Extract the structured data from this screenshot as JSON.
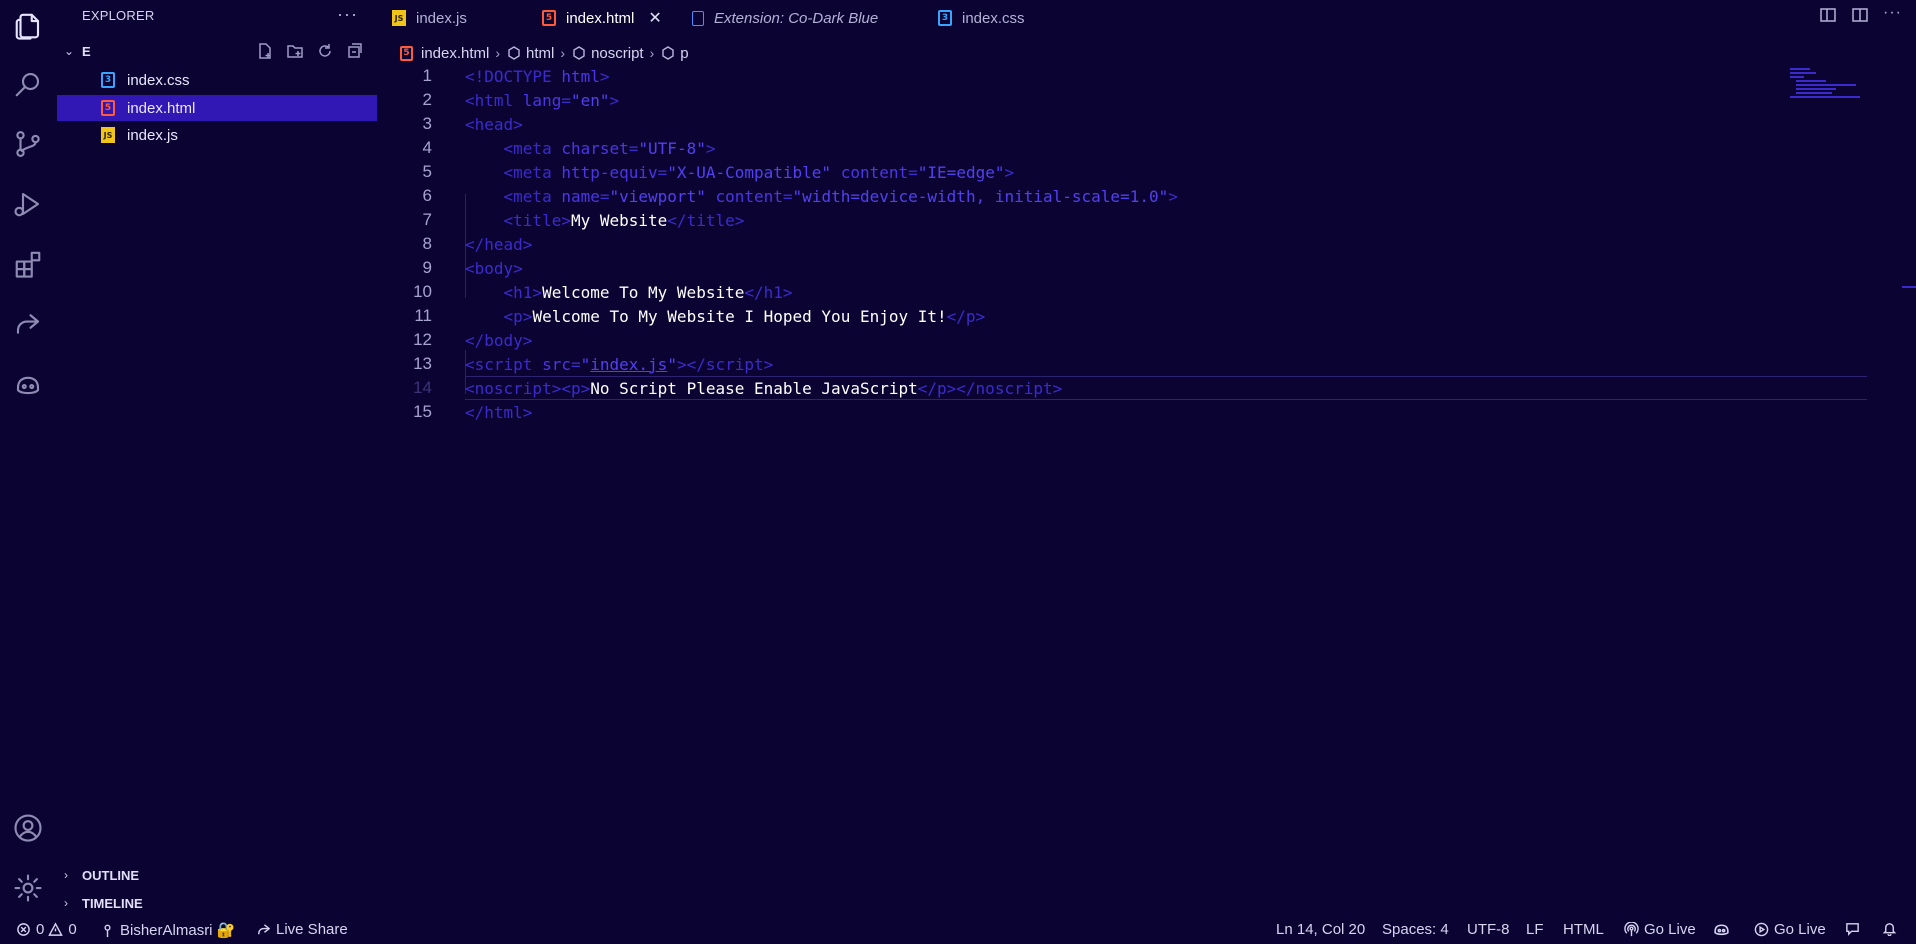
{
  "sidebar": {
    "title": "EXPLORER",
    "folder": "E",
    "files": [
      {
        "name": "index.css",
        "type": "css",
        "selected": false
      },
      {
        "name": "index.html",
        "type": "html",
        "selected": true
      },
      {
        "name": "index.js",
        "type": "js",
        "selected": false
      }
    ],
    "panels": [
      "OUTLINE",
      "TIMELINE"
    ]
  },
  "tabs": [
    {
      "label": "index.js",
      "icon": "js-file-icon"
    },
    {
      "label": "index.html",
      "icon": "html-file-icon",
      "active": true
    },
    {
      "label": "Extension: Co-Dark Blue",
      "icon": "file-icon",
      "italic": true
    },
    {
      "label": "index.css",
      "icon": "css-file-icon"
    }
  ],
  "breadcrumb": [
    "index.html",
    "html",
    "noscript",
    "p"
  ],
  "editor": {
    "line_numbers": [
      "1",
      "2",
      "3",
      "4",
      "5",
      "6",
      "7",
      "8",
      "9",
      "10",
      "11",
      "12",
      "13",
      "14",
      "15"
    ],
    "current_line": 14,
    "text": {
      "title_text": "My Website",
      "h1_text": "Welcome To My Website",
      "p_text": "Welcome To My Website I Hoped You Enjoy It!",
      "script_src": "index.js",
      "noscript_text": "No Script Please Enable JavaScript"
    }
  },
  "status": {
    "errors": "0",
    "warnings": "0",
    "account": "BisherAlmasri 🔐",
    "live_share": "Live Share",
    "cursor": "Ln 14, Col 20",
    "spaces": "Spaces: 4",
    "encoding": "UTF-8",
    "eol": "LF",
    "language": "HTML",
    "go_live_1": "Go Live",
    "go_live_2": "Go Live"
  },
  "colors": {
    "background": "#0b0433",
    "tag": "#3b2bcf",
    "selection": "#3117b3",
    "text": "#ffffff"
  }
}
